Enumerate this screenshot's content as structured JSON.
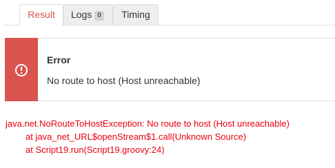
{
  "tabs": [
    {
      "label": "Result",
      "active": true
    },
    {
      "label": "Logs",
      "badge": "0",
      "active": false
    },
    {
      "label": "Timing",
      "active": false
    }
  ],
  "alert": {
    "icon": "exclamation-circle-icon",
    "title": "Error",
    "message": "No route to host (Host unreachable)",
    "accent_color": "#d9534f"
  },
  "stacktrace": {
    "color": "#e8000d",
    "lines": [
      "java.net.NoRouteToHostException: No route to host (Host unreachable)",
      "at java_net_URL$openStream$1.call(Unknown Source)",
      "at Script19.run(Script19.groovy:24)"
    ]
  }
}
